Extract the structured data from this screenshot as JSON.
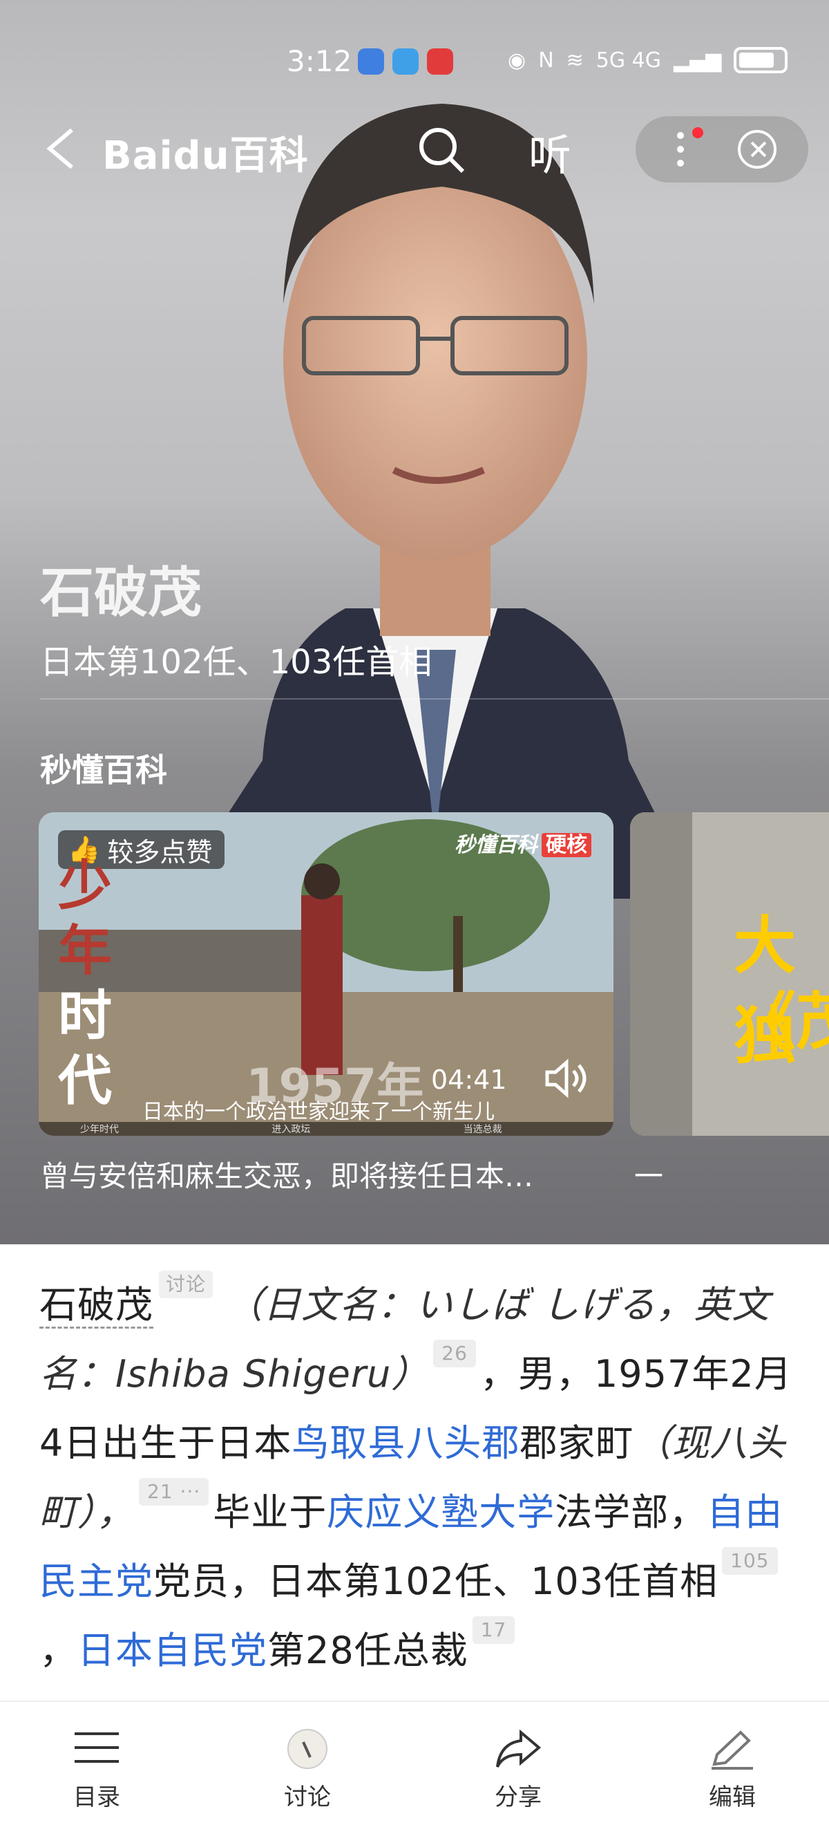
{
  "status": {
    "time": "3:12",
    "right_text": "5G 4G"
  },
  "header": {
    "logo": "Baidu百科",
    "listen_label": "听"
  },
  "hero": {
    "name": "石破茂",
    "subtitle": "日本第102任、103任首相",
    "section_title": "秒懂百科"
  },
  "video1": {
    "badge": "较多点赞",
    "brand": "秒懂百科",
    "brand_tag": "硬核",
    "title_chars": [
      "少",
      "年",
      "时",
      "代"
    ],
    "year": "1957年",
    "duration": "04:41",
    "caption": "日本的一个政治世家迎来了一个新生儿",
    "chapters": [
      "少年时代",
      "进入政坛",
      "当选总裁"
    ],
    "description": "曾与安倍和麻生交恶，即将接任日本…"
  },
  "video2": {
    "title_a": "大独",
    "title_b": "《茂",
    "description": "一"
  },
  "article": {
    "name": "石破茂",
    "discuss_tag": "讨论",
    "jp_name": "（日文名：いしば しげる，英文名：Ishiba Shigeru）",
    "ref1": "26",
    "text1": "，男，1957年2月4日出生于日本",
    "link_birth": "鸟取县八头郡",
    "text2": "郡家町",
    "now_prefix": "（现",
    "link_now": "八头町",
    "now_suffix": "），",
    "ref2": "21 ···",
    "text3": "毕业于",
    "link_uni": "庆应义塾大学",
    "text4": "法学部，",
    "link_party": "自由民主党",
    "text5": "党员，日本第102任、103任首相",
    "ref3": "105",
    "text6": "，",
    "link_ldp": "日本自民党",
    "text7": "第28任总裁",
    "ref4": "17"
  },
  "bottom_nav": [
    {
      "label": "目录",
      "icon": "menu-icon"
    },
    {
      "label": "讨论",
      "icon": "discussion-avatar-icon"
    },
    {
      "label": "分享",
      "icon": "share-icon"
    },
    {
      "label": "编辑",
      "icon": "edit-icon"
    }
  ],
  "colors": {
    "link": "#2f6bd6",
    "badge_red": "#ff2d3a",
    "title_red": "#b63a2f"
  }
}
